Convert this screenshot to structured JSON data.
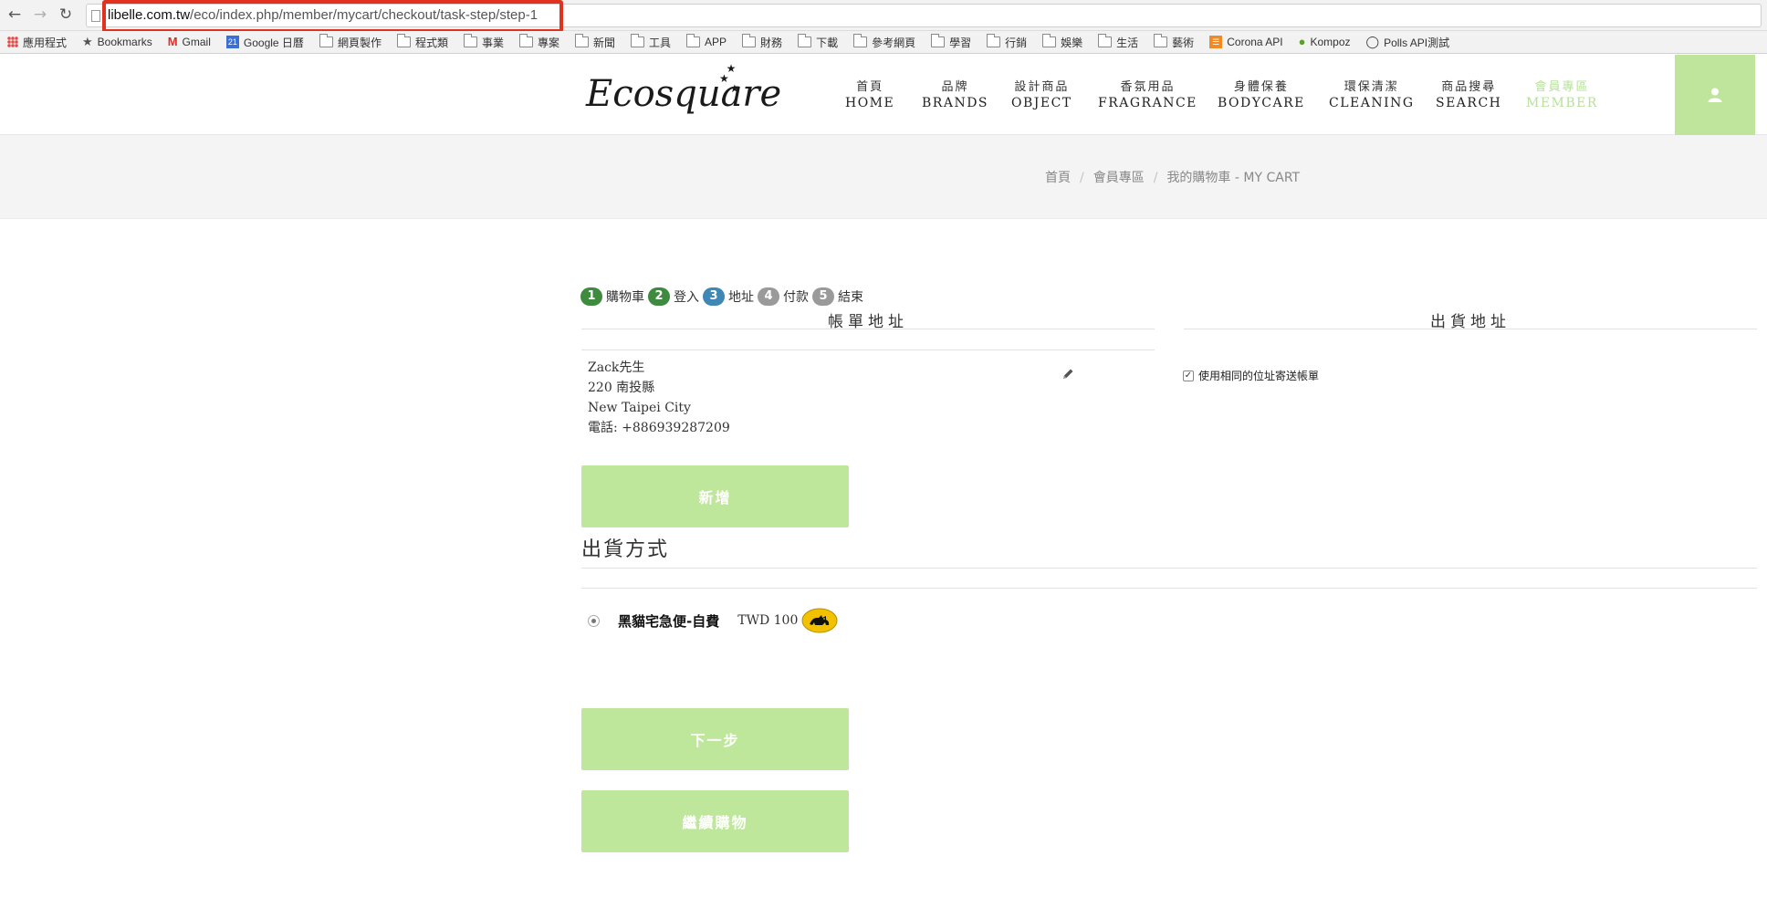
{
  "browser": {
    "url_host": "libelle.com.tw",
    "url_path": "/eco/index.php/member/mycart/checkout/task-step/step-1",
    "bookmarks": [
      {
        "label": "應用程式",
        "icon": "apps-icon"
      },
      {
        "label": "Bookmarks",
        "icon": "star-icon"
      },
      {
        "label": "Gmail",
        "icon": "gmail-icon"
      },
      {
        "label": "Google 日曆",
        "icon": "calendar-icon"
      },
      {
        "label": "網頁製作",
        "icon": "folder-icon"
      },
      {
        "label": "程式類",
        "icon": "folder-icon"
      },
      {
        "label": "事業",
        "icon": "folder-icon"
      },
      {
        "label": "專案",
        "icon": "folder-icon"
      },
      {
        "label": "新聞",
        "icon": "folder-icon"
      },
      {
        "label": "工具",
        "icon": "folder-icon"
      },
      {
        "label": "APP",
        "icon": "folder-icon"
      },
      {
        "label": "財務",
        "icon": "folder-icon"
      },
      {
        "label": "下載",
        "icon": "folder-icon"
      },
      {
        "label": "參考網頁",
        "icon": "folder-icon"
      },
      {
        "label": "學習",
        "icon": "folder-icon"
      },
      {
        "label": "行銷",
        "icon": "folder-icon"
      },
      {
        "label": "娛樂",
        "icon": "folder-icon"
      },
      {
        "label": "生活",
        "icon": "folder-icon"
      },
      {
        "label": "藝術",
        "icon": "folder-icon"
      },
      {
        "label": "Corona API",
        "icon": "corona-icon"
      },
      {
        "label": "Kompoz",
        "icon": "kompoz-icon"
      },
      {
        "label": "Polls API測試",
        "icon": "github-icon"
      }
    ]
  },
  "site": {
    "logo": "Ecosquare",
    "menu": [
      {
        "zh": "首頁",
        "en": "HOME"
      },
      {
        "zh": "品牌",
        "en": "BRANDS"
      },
      {
        "zh": "設計商品",
        "en": "OBJECT"
      },
      {
        "zh": "香氛用品",
        "en": "FRAGRANCE"
      },
      {
        "zh": "身體保養",
        "en": "BODYCARE"
      },
      {
        "zh": "環保清潔",
        "en": "CLEANING"
      },
      {
        "zh": "商品搜尋",
        "en": "SEARCH"
      },
      {
        "zh": "會員專區",
        "en": "MEMBER"
      }
    ],
    "active_menu": "MEMBER",
    "accent_color": "#bfe59c"
  },
  "breadcrumb": [
    "首頁",
    "會員專區",
    "我的購物車 - MY CART"
  ],
  "steps": [
    {
      "num": "1",
      "label": "購物車",
      "state": "done"
    },
    {
      "num": "2",
      "label": "登入",
      "state": "done"
    },
    {
      "num": "3",
      "label": "地址",
      "state": "current"
    },
    {
      "num": "4",
      "label": "付款",
      "state": "todo"
    },
    {
      "num": "5",
      "label": "結束",
      "state": "todo"
    }
  ],
  "billing": {
    "title": "帳單地址",
    "lines": [
      "Zack先生",
      "220 南投縣",
      "New Taipei City",
      "電話: +886939287209"
    ],
    "add_button": "新增"
  },
  "shipping_address": {
    "title": "出貨地址",
    "same_as_billing_label": "使用相同的位址寄送帳單",
    "same_as_billing_checked": true
  },
  "shipping_method": {
    "title": "出貨方式",
    "option_name": "黑貓宅急便-自費",
    "option_price": "TWD 100",
    "selected": true
  },
  "actions": {
    "next": "下一步",
    "continue_shopping": "繼續購物"
  }
}
